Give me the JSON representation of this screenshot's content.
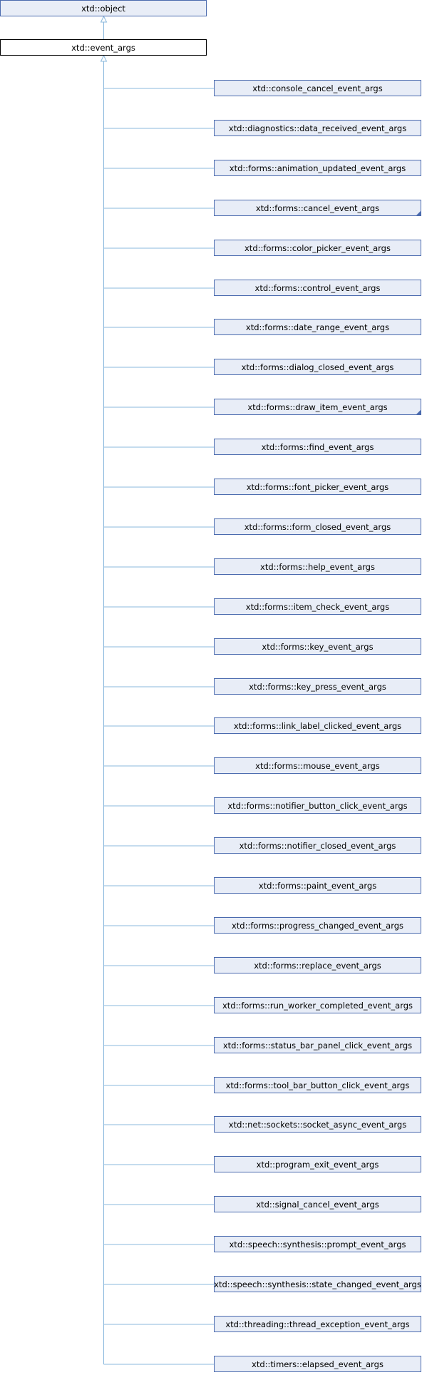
{
  "diagram": {
    "root": {
      "label": "xtd::object"
    },
    "current": {
      "label": "xtd::event_args"
    },
    "children": [
      {
        "label": "xtd::console_cancel_event_args",
        "has_more": false
      },
      {
        "label": "xtd::diagnostics::data_received_event_args",
        "has_more": false
      },
      {
        "label": "xtd::forms::animation_updated_event_args",
        "has_more": false
      },
      {
        "label": "xtd::forms::cancel_event_args",
        "has_more": true
      },
      {
        "label": "xtd::forms::color_picker_event_args",
        "has_more": false
      },
      {
        "label": "xtd::forms::control_event_args",
        "has_more": false
      },
      {
        "label": "xtd::forms::date_range_event_args",
        "has_more": false
      },
      {
        "label": "xtd::forms::dialog_closed_event_args",
        "has_more": false
      },
      {
        "label": "xtd::forms::draw_item_event_args",
        "has_more": true
      },
      {
        "label": "xtd::forms::find_event_args",
        "has_more": false
      },
      {
        "label": "xtd::forms::font_picker_event_args",
        "has_more": false
      },
      {
        "label": "xtd::forms::form_closed_event_args",
        "has_more": false
      },
      {
        "label": "xtd::forms::help_event_args",
        "has_more": false
      },
      {
        "label": "xtd::forms::item_check_event_args",
        "has_more": false
      },
      {
        "label": "xtd::forms::key_event_args",
        "has_more": false
      },
      {
        "label": "xtd::forms::key_press_event_args",
        "has_more": false
      },
      {
        "label": "xtd::forms::link_label_clicked_event_args",
        "has_more": false
      },
      {
        "label": "xtd::forms::mouse_event_args",
        "has_more": false
      },
      {
        "label": "xtd::forms::notifier_button_click_event_args",
        "has_more": false
      },
      {
        "label": "xtd::forms::notifier_closed_event_args",
        "has_more": false
      },
      {
        "label": "xtd::forms::paint_event_args",
        "has_more": false
      },
      {
        "label": "xtd::forms::progress_changed_event_args",
        "has_more": false
      },
      {
        "label": "xtd::forms::replace_event_args",
        "has_more": false
      },
      {
        "label": "xtd::forms::run_worker_completed_event_args",
        "has_more": false
      },
      {
        "label": "xtd::forms::status_bar_panel_click_event_args",
        "has_more": false
      },
      {
        "label": "xtd::forms::tool_bar_button_click_event_args",
        "has_more": false
      },
      {
        "label": "xtd::net::sockets::socket_async_event_args",
        "has_more": false
      },
      {
        "label": "xtd::program_exit_event_args",
        "has_more": false
      },
      {
        "label": "xtd::signal_cancel_event_args",
        "has_more": false
      },
      {
        "label": "xtd::speech::synthesis::prompt_event_args",
        "has_more": false
      },
      {
        "label": "xtd::speech::synthesis::state_changed_event_args",
        "has_more": false
      },
      {
        "label": "xtd::threading::thread_exception_event_args",
        "has_more": false
      },
      {
        "label": "xtd::timers::elapsed_event_args",
        "has_more": false
      }
    ]
  },
  "colors": {
    "node_fill": "#e8edf7",
    "node_border": "#4a6aae",
    "edge": "#8bb8dd",
    "current_border": "#000000"
  }
}
